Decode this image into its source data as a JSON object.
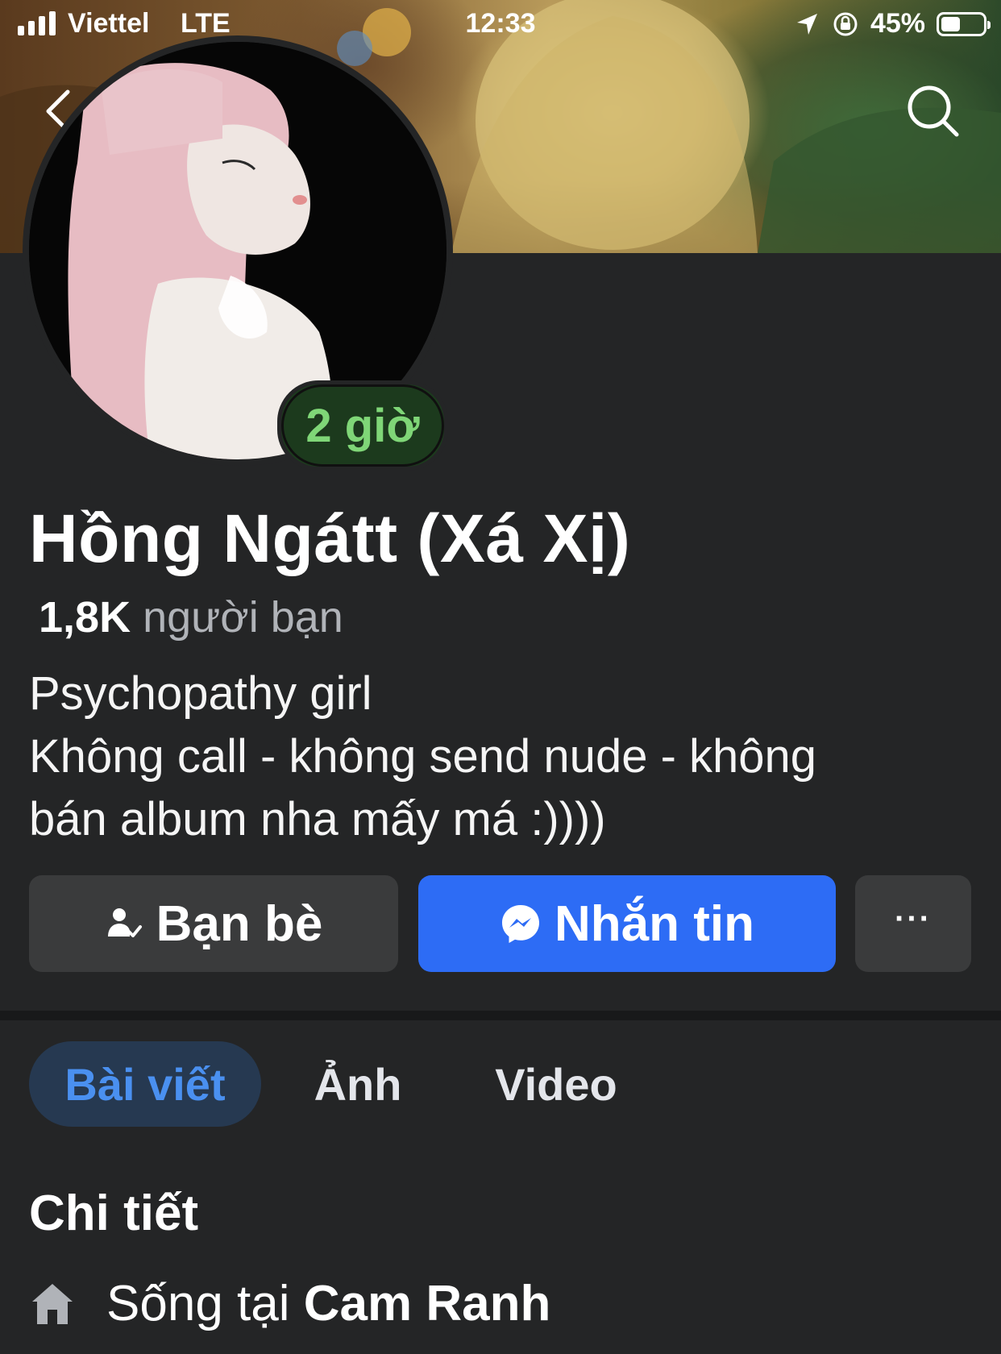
{
  "status_bar": {
    "carrier": "Viettel",
    "network": "LTE",
    "time": "12:33",
    "battery_percent": "45%",
    "battery_level": 0.45
  },
  "profile": {
    "name": "Hồng Ngátt (Xá Xị)",
    "story_badge": "2 giờ",
    "friends_count": "1,8K",
    "friends_label": "người bạn",
    "bio_lines": [
      "Psychopathy girl",
      "Không call - không send nude - không",
      "bán album nha mấy má :))))"
    ]
  },
  "actions": {
    "friends_label": "Bạn bè",
    "message_label": "Nhắn tin",
    "more_label": "···"
  },
  "tabs": [
    {
      "label": "Bài viết",
      "active": true
    },
    {
      "label": "Ảnh",
      "active": false
    },
    {
      "label": "Video",
      "active": false
    }
  ],
  "details": {
    "title": "Chi tiết",
    "lives_in_prefix": "Sống tại",
    "lives_in_place": "Cam Ranh"
  },
  "colors": {
    "background": "#242526",
    "accent_blue": "#2d6cf5",
    "active_tab_text": "#4a90f0",
    "story_green": "#7fd677"
  },
  "icons": [
    "back-chevron-icon",
    "search-icon",
    "location-arrow-icon",
    "rotation-lock-icon",
    "friend-check-icon",
    "messenger-icon",
    "home-icon"
  ]
}
